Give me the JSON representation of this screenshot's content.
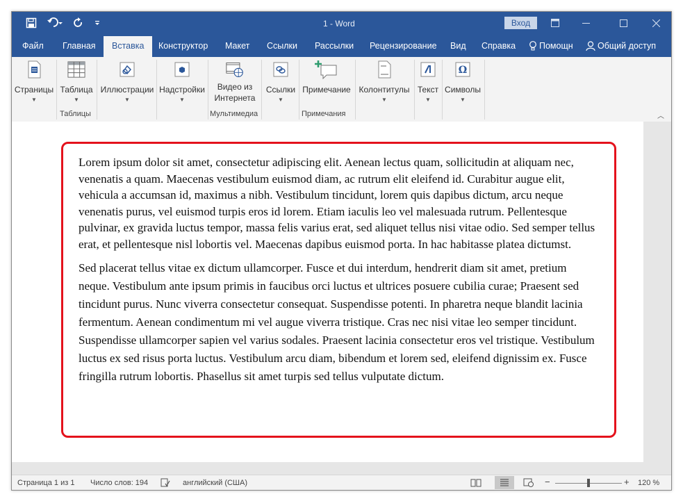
{
  "titlebar": {
    "title": "1  -  Word",
    "signin": "Вход"
  },
  "tabs": [
    "Файл",
    "Главная",
    "Вставка",
    "Конструктор",
    "Макет",
    "Ссылки",
    "Рассылки",
    "Рецензирование",
    "Вид",
    "Справка"
  ],
  "active_tab": "Вставка",
  "help": "Помощн",
  "share": "Общий доступ",
  "ribbon": {
    "pages": "Страницы",
    "table": "Таблица",
    "illustrations": "Иллюстрации",
    "addins": "Надстройки",
    "video_line1": "Видео из",
    "video_line2": "Интернета",
    "links": "Ссылки",
    "comment": "Примечание",
    "header_footer": "Колонтитулы",
    "text": "Текст",
    "symbols": "Символы",
    "group_tables": "Таблицы",
    "group_media": "Мультимедиа",
    "group_comments": "Примечания"
  },
  "document": {
    "paragraph1": "Lorem ipsum dolor sit amet, consectetur adipiscing elit. Aenean lectus quam, sollicitudin at aliquam nec, venenatis a quam. Maecenas vestibulum euismod diam, ac rutrum elit eleifend id. Curabitur augue elit, vehicula a accumsan id, maximus a nibh. Vestibulum tincidunt, lorem quis dapibus dictum, arcu neque venenatis purus, vel euismod turpis eros id lorem. Etiam iaculis leo vel malesuada rutrum. Pellentesque pulvinar, ex gravida luctus tempor, massa felis varius erat, sed aliquet tellus nisi vitae odio. Sed semper tellus erat, et pellentesque nisl lobortis vel. Maecenas dapibus euismod porta. In hac habitasse platea dictumst.",
    "paragraph2": "Sed placerat tellus vitae ex dictum ullamcorper. Fusce et dui interdum, hendrerit diam sit amet, pretium neque. Vestibulum ante ipsum primis in faucibus orci luctus et ultrices posuere cubilia curae; Praesent sed tincidunt purus. Nunc viverra consectetur consequat. Suspendisse potenti. In pharetra neque blandit lacinia fermentum. Aenean condimentum mi vel augue viverra tristique. Cras nec nisi vitae leo semper tincidunt. Suspendisse ullamcorper sapien vel varius sodales. Praesent lacinia consectetur eros vel tristique. Vestibulum luctus ex sed risus porta luctus. Vestibulum arcu diam, bibendum et lorem sed, eleifend dignissim ex. Fusce fringilla rutrum lobortis. Phasellus sit amet turpis sed tellus vulputate dictum."
  },
  "status": {
    "page": "Страница 1 из 1",
    "words": "Число слов: 194",
    "language": "английский (США)",
    "zoom": "120 %"
  },
  "colors": {
    "brand": "#2b579a",
    "highlight": "#e4121c"
  }
}
